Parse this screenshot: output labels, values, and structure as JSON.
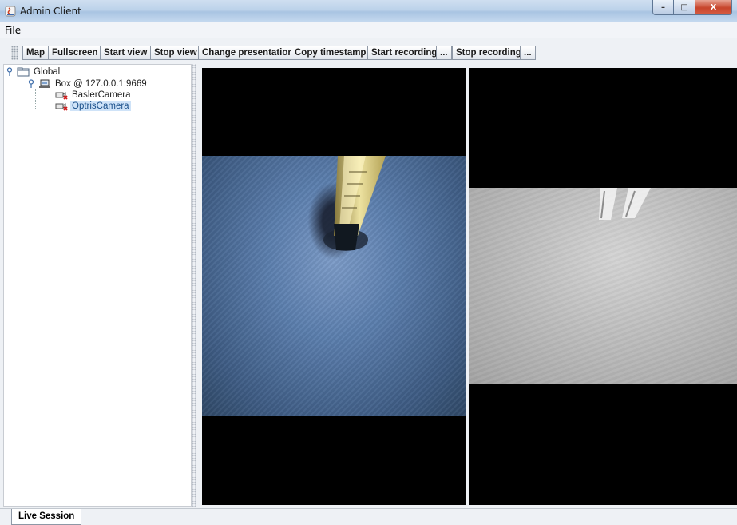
{
  "window": {
    "title": "Admin Client",
    "buttons": {
      "minimize": "–",
      "maximize": "□",
      "close": "X"
    }
  },
  "menu": {
    "items": [
      "File"
    ]
  },
  "toolbar": {
    "buttons": [
      "Map",
      "Fullscreen",
      "Start view",
      "Stop view",
      "Change presentation",
      "Copy timestamp",
      "Start recording",
      "...",
      "Stop recording",
      "..."
    ]
  },
  "tree": {
    "root": {
      "label": "Global",
      "expanded": true
    },
    "box": {
      "label": "Box @ 127.0.0.1:9669",
      "expanded": true
    },
    "cameras": [
      {
        "label": "BaslerCamera",
        "selected": false
      },
      {
        "label": "OptrisCamera",
        "selected": true
      }
    ]
  },
  "views": {
    "left": {
      "camera": "BaslerCamera",
      "feed": "color"
    },
    "right": {
      "camera": "OptrisCamera",
      "feed": "grayscale"
    }
  },
  "tabs": [
    "Live Session"
  ]
}
